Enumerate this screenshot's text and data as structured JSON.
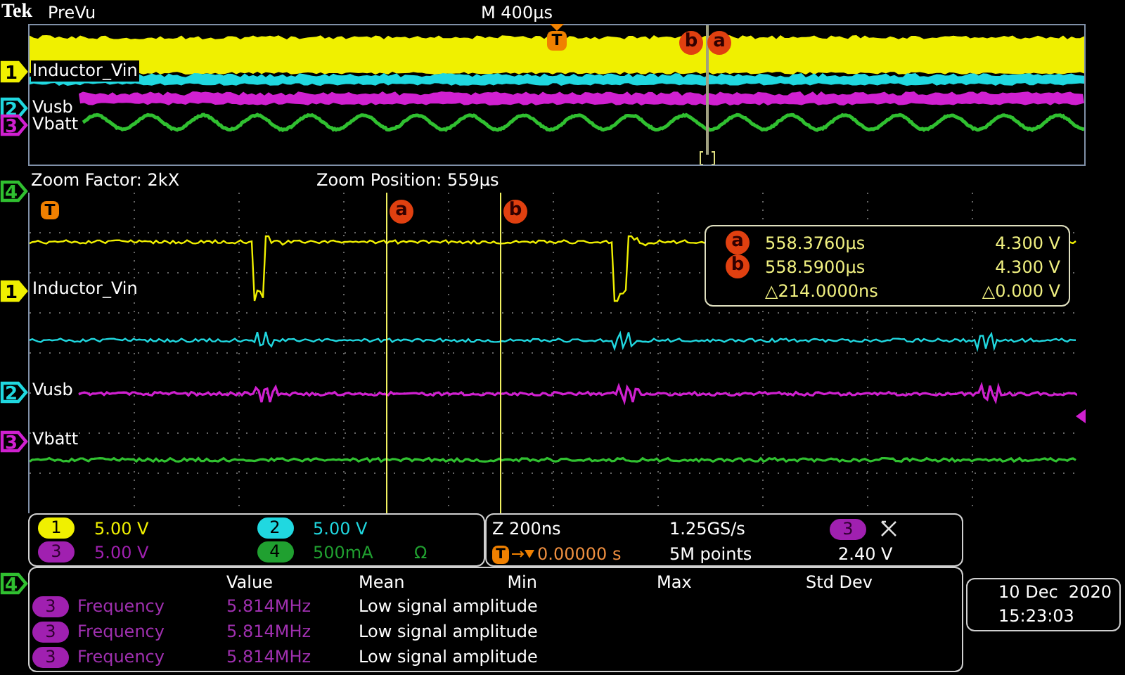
{
  "header": {
    "brand": "Tek",
    "mode": "PreVu",
    "horizontal_scale": "M 400µs"
  },
  "overview": {
    "trigger_marker": "T",
    "cursor_markers": [
      "b",
      "a"
    ]
  },
  "channels": [
    {
      "number": "1",
      "label": "Inductor_Vin",
      "color": "#f0f000",
      "selected": true
    },
    {
      "number": "2",
      "label": "Vusb",
      "color": "#20d8e0",
      "selected": false
    },
    {
      "number": "3",
      "label": "Vbatt",
      "color": "#d020d0",
      "selected": false
    },
    {
      "number": "4",
      "color": "#30c030",
      "selected": false
    }
  ],
  "zoom": {
    "factor": "Zoom Factor: 2kX",
    "position": "Zoom Position: 559µs",
    "trigger_marker": "T",
    "cursor_markers": [
      "a",
      "b"
    ],
    "channels": [
      {
        "number": "1",
        "label": "Inductor_Vin",
        "color": "#f0f000",
        "selected": true
      },
      {
        "number": "2",
        "label": "Vusb",
        "color": "#20d8e0",
        "selected": false
      },
      {
        "number": "3",
        "label": "Vbatt",
        "color": "#d020d0",
        "selected": false
      }
    ],
    "readout": [
      {
        "marker": "a",
        "time": "558.3760µs",
        "voltage": "4.300 V"
      },
      {
        "marker": "b",
        "time": "558.5900µs",
        "voltage": "4.300 V"
      },
      {
        "time": "△214.0000ns",
        "voltage": "△0.000 V"
      }
    ]
  },
  "channel_settings": [
    {
      "number": "1",
      "scale": "5.00 V",
      "color": "#f0f000",
      "dim": false
    },
    {
      "number": "2",
      "scale": "5.00 V",
      "color": "#20d8e0",
      "dim": false
    },
    {
      "number": "3",
      "scale": "5.00 V",
      "color": "#a020b0",
      "dim": true
    },
    {
      "number": "4",
      "scale": "500mA",
      "color": "#20a030",
      "dim": false,
      "extra": "Ω"
    }
  ],
  "timebase": {
    "zoom_scale": "Z 200ns",
    "sample_rate": "1.25GS/s",
    "trigger_badge": "T",
    "trigger_position": "0.00000 s",
    "record_length": "5M points",
    "trigger_source": "3",
    "trigger_level": "2.40 V"
  },
  "measurements": {
    "channel": "4",
    "columns": [
      "Value",
      "Mean",
      "Min",
      "Max",
      "Std Dev"
    ],
    "rows": [
      {
        "source": "3",
        "name": "Frequency",
        "value": "5.814MHz",
        "mean": "Low signal amplitude"
      },
      {
        "source": "3",
        "name": "Frequency",
        "value": "5.814MHz",
        "mean": "Low signal amplitude"
      },
      {
        "source": "3",
        "name": "Frequency",
        "value": "5.814MHz",
        "mean": "Low signal amplitude"
      }
    ]
  },
  "clock": {
    "date": "10 Dec  2020",
    "time": "15:23:03"
  }
}
